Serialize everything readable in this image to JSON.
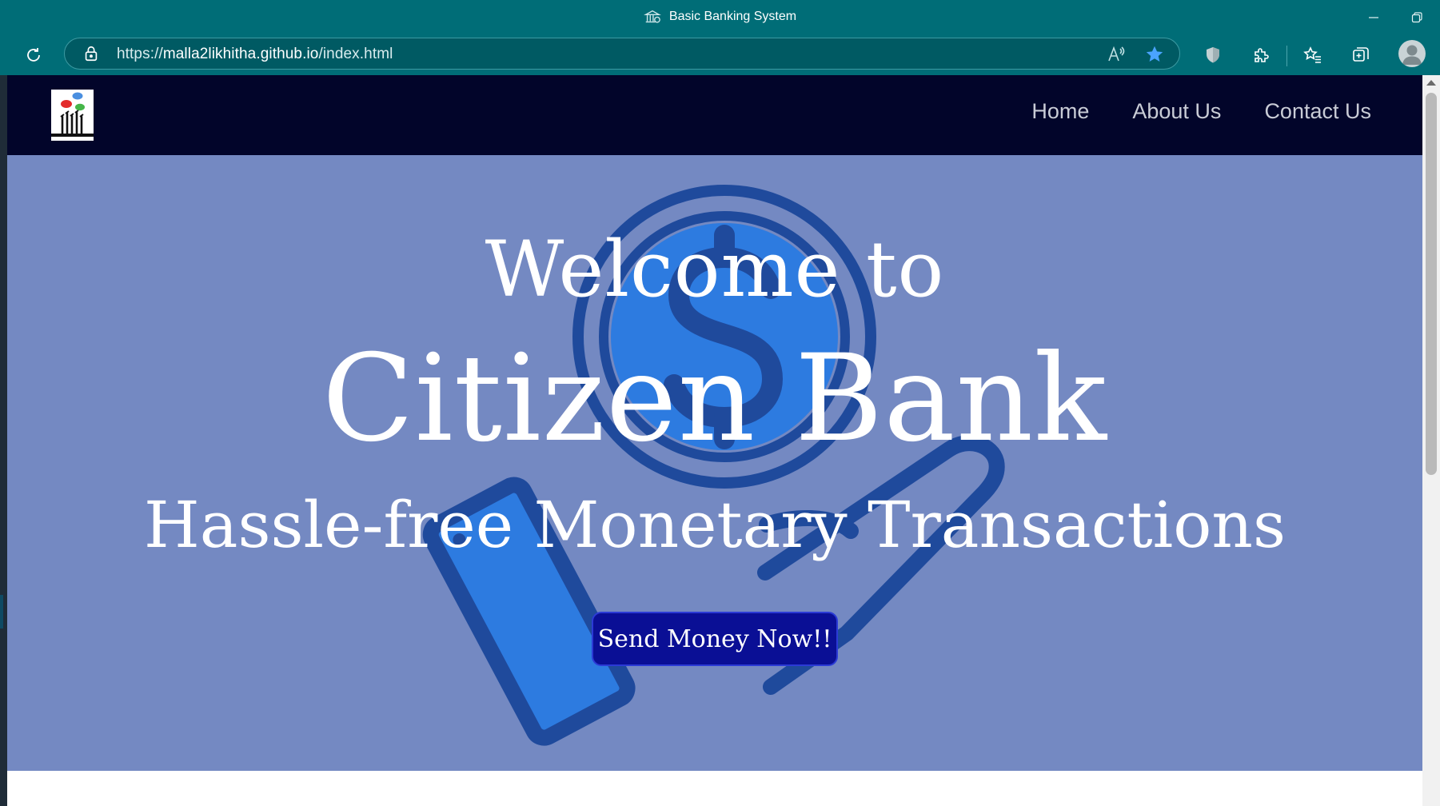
{
  "browser": {
    "window_title": "Basic Banking System",
    "url_scheme": "https://",
    "url_host": "malla2likhitha.github.io",
    "url_path": "/index.html",
    "colors": {
      "chrome": "#006d77",
      "address_bar": "#005a63",
      "star": "#4aa3ff"
    }
  },
  "navbar": {
    "links": [
      {
        "label": "Home"
      },
      {
        "label": "About Us"
      },
      {
        "label": "Contact Us"
      }
    ],
    "colors": {
      "background": "#02052a",
      "link": "#c9ccd6"
    }
  },
  "hero": {
    "line1": "Welcome to",
    "line2": "Citizen Bank",
    "line3": "Hassle-free Monetary Transactions",
    "cta_label": "Send Money Now!!",
    "colors": {
      "background": "#7489c2",
      "illustration_blue": "#2d7be0",
      "illustration_outline": "#1f4a9c",
      "cta": "#0a0f95"
    }
  }
}
